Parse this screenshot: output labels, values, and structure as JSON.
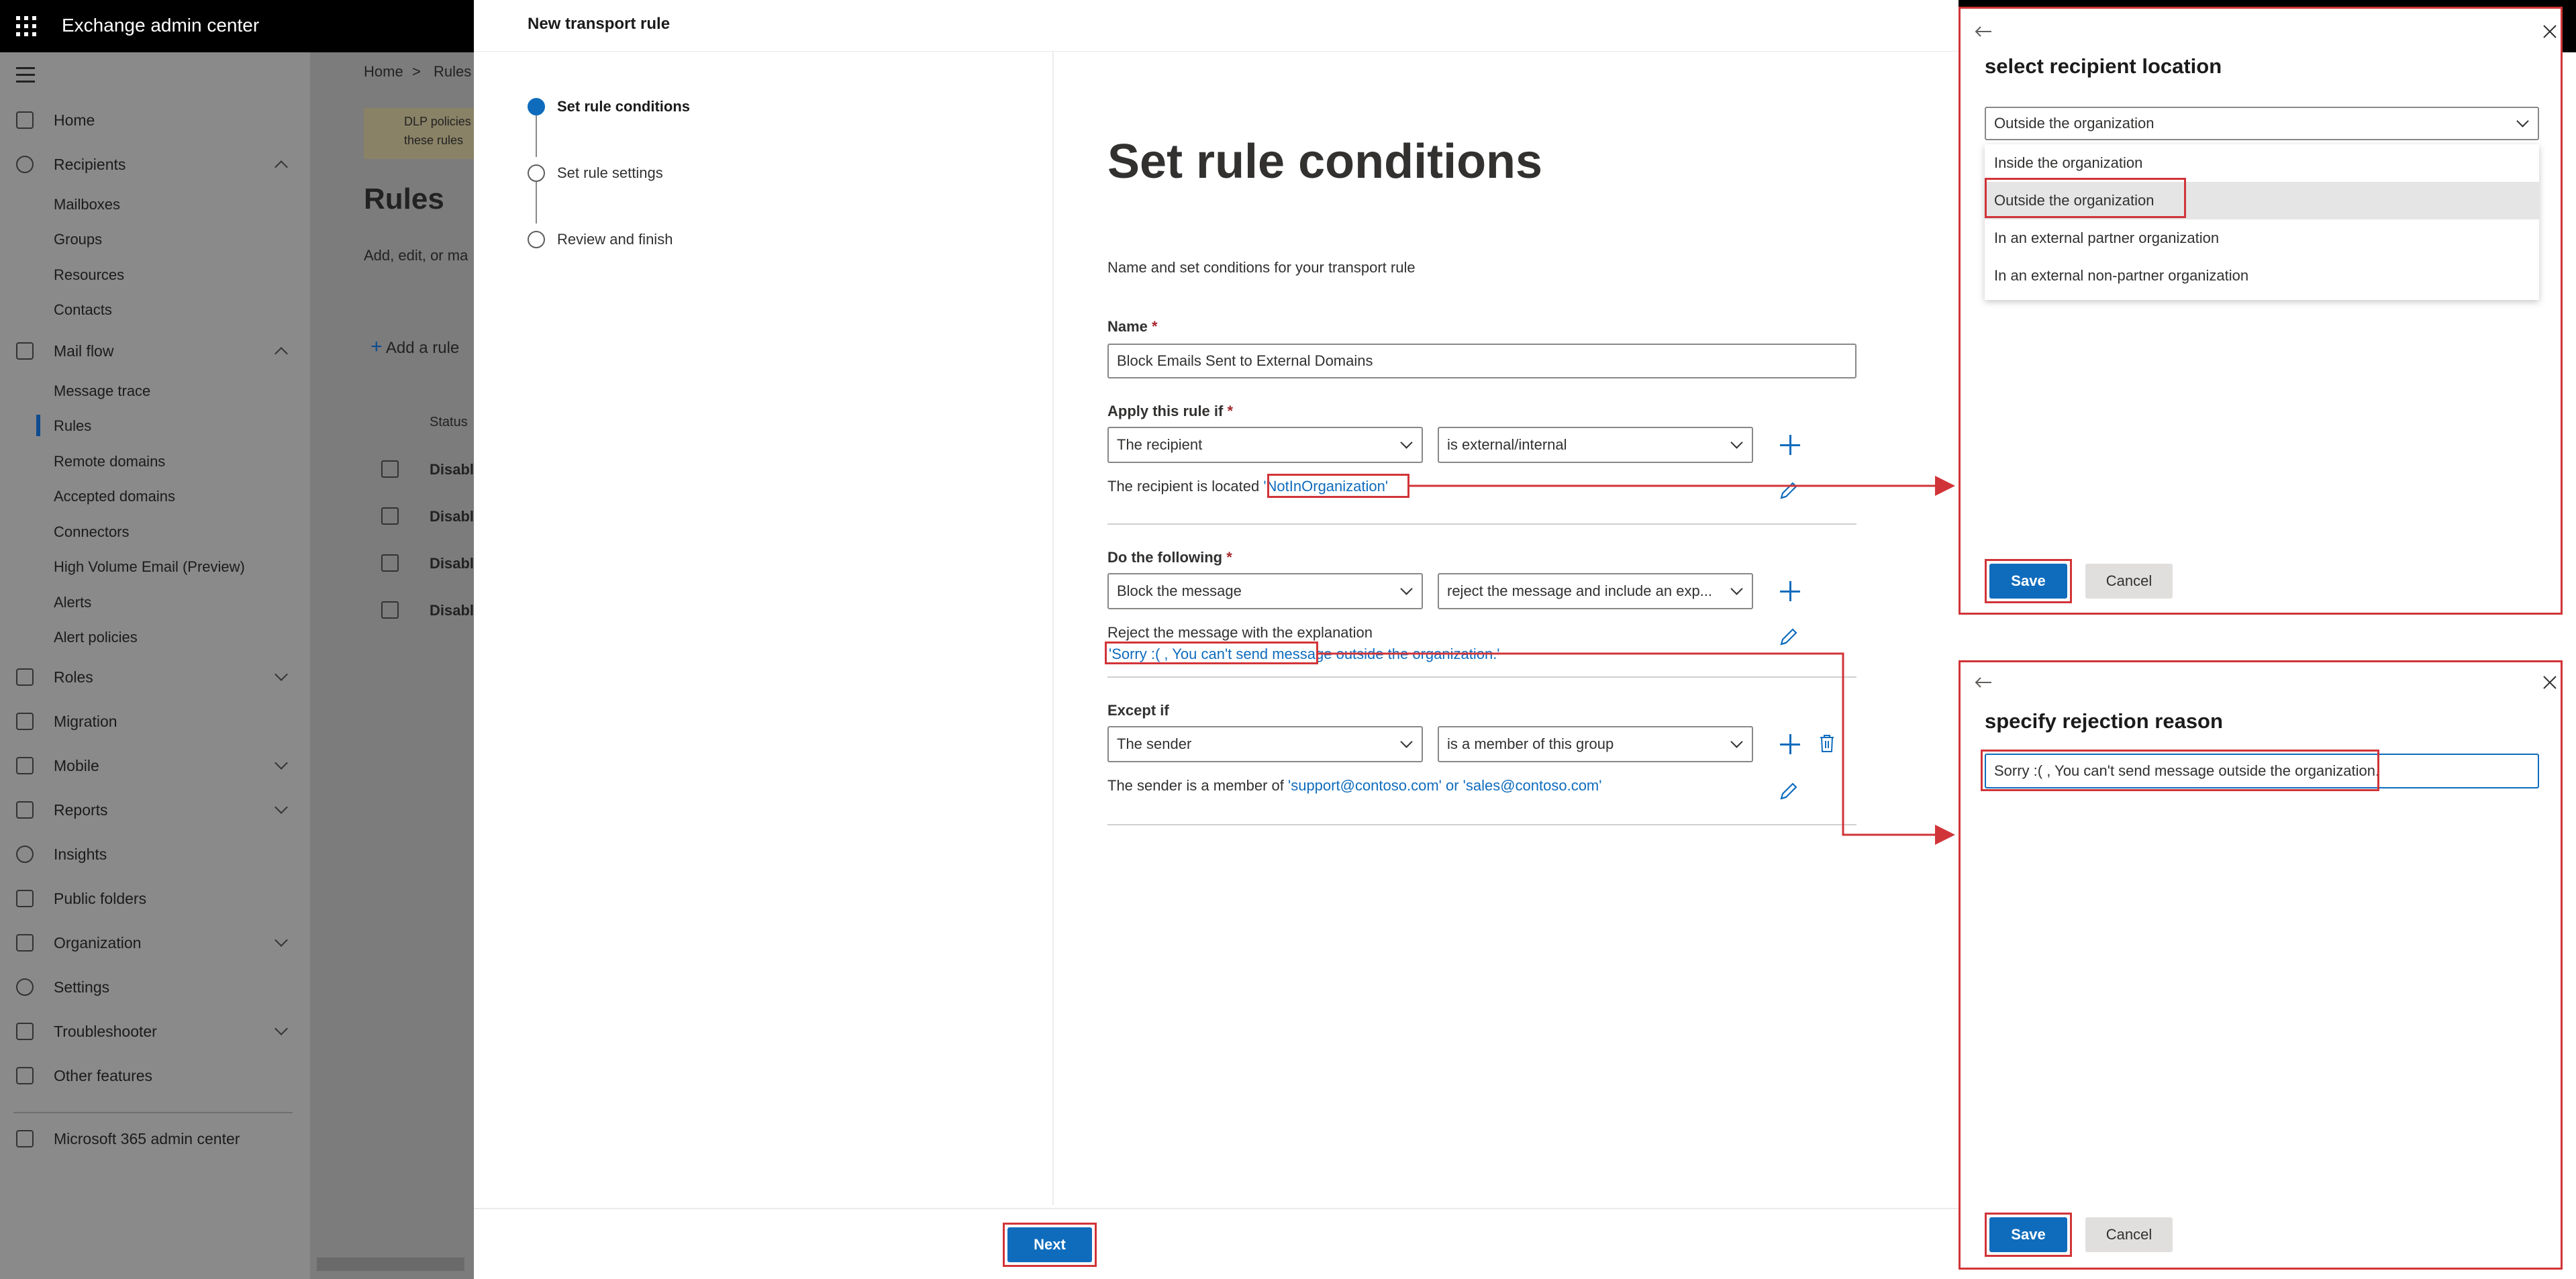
{
  "app": {
    "title": "Exchange admin center"
  },
  "nav": {
    "home": "Home",
    "recipients": "Recipients",
    "mailboxes": "Mailboxes",
    "groups": "Groups",
    "resources": "Resources",
    "contacts": "Contacts",
    "mail_flow": "Mail flow",
    "message_trace": "Message trace",
    "rules": "Rules",
    "remote_domains": "Remote domains",
    "accepted_domains": "Accepted domains",
    "connectors": "Connectors",
    "high_volume_email": "High Volume Email (Preview)",
    "alerts": "Alerts",
    "alert_policies": "Alert policies",
    "roles": "Roles",
    "migration": "Migration",
    "mobile": "Mobile",
    "reports": "Reports",
    "insights": "Insights",
    "public_folders": "Public folders",
    "organization": "Organization",
    "settings": "Settings",
    "troubleshooter": "Troubleshooter",
    "other_features": "Other features",
    "m365_admin_center": "Microsoft 365 admin center"
  },
  "background": {
    "breadcrumb_home": "Home",
    "breadcrumb_sep": ">",
    "breadcrumb_rules": "Rules",
    "dlp_line1": "DLP policies",
    "dlp_line2": "these rules",
    "page_title": "Rules",
    "page_desc": "Add, edit, or ma",
    "add_rule": "Add a rule",
    "status_header": "Status",
    "row_status": "Disabl"
  },
  "panel": {
    "title": "New transport rule",
    "steps": [
      "Set rule conditions",
      "Set rule settings",
      "Review and finish"
    ],
    "heading": "Set rule conditions",
    "subheading": "Name and set conditions for your transport rule",
    "name_label": "Name",
    "required_mark": "*",
    "name_value": "Block Emails Sent to External Domains",
    "apply_label": "Apply this rule if",
    "apply_dd1": "The recipient",
    "apply_dd2": "is external/internal",
    "apply_summary_prefix": "The recipient is located ",
    "apply_summary_value": "'NotInOrganization'",
    "do_label": "Do the following",
    "do_dd1": "Block the message",
    "do_dd2": "reject the message and include an exp...",
    "do_summary_prefix": "Reject the message with the explanation",
    "do_summary_value": "'Sorry :( , You can't send message outside the organization.'",
    "except_label": "Except if",
    "except_dd1": "The sender",
    "except_dd2": "is a member of this group",
    "except_summary_prefix": "The sender is a member of ",
    "except_summary_value": "'support@contoso.com' or 'sales@contoso.com'",
    "next_label": "Next"
  },
  "location_flyout": {
    "title": "select recipient location",
    "selected": "Outside the organization",
    "options": [
      "Inside the organization",
      "Outside the organization",
      "In an external partner organization",
      "In an external non-partner organization"
    ],
    "save": "Save",
    "cancel": "Cancel"
  },
  "rejection_flyout": {
    "title": "specify rejection reason",
    "value": "Sorry :( , You can't send message outside the organization.",
    "save": "Save",
    "cancel": "Cancel"
  },
  "colors": {
    "accent": "#0f6cbd",
    "highlight_border": "#d13438",
    "overlay": "#8a8a8a",
    "header": "#000000"
  },
  "icons": {
    "app_launcher": "waffle-icon",
    "nav_toggle": "hamburger-icon",
    "add": "plus-icon",
    "edit": "pencil-icon",
    "delete": "trash-icon",
    "back": "back-arrow-icon",
    "close": "close-icon"
  }
}
